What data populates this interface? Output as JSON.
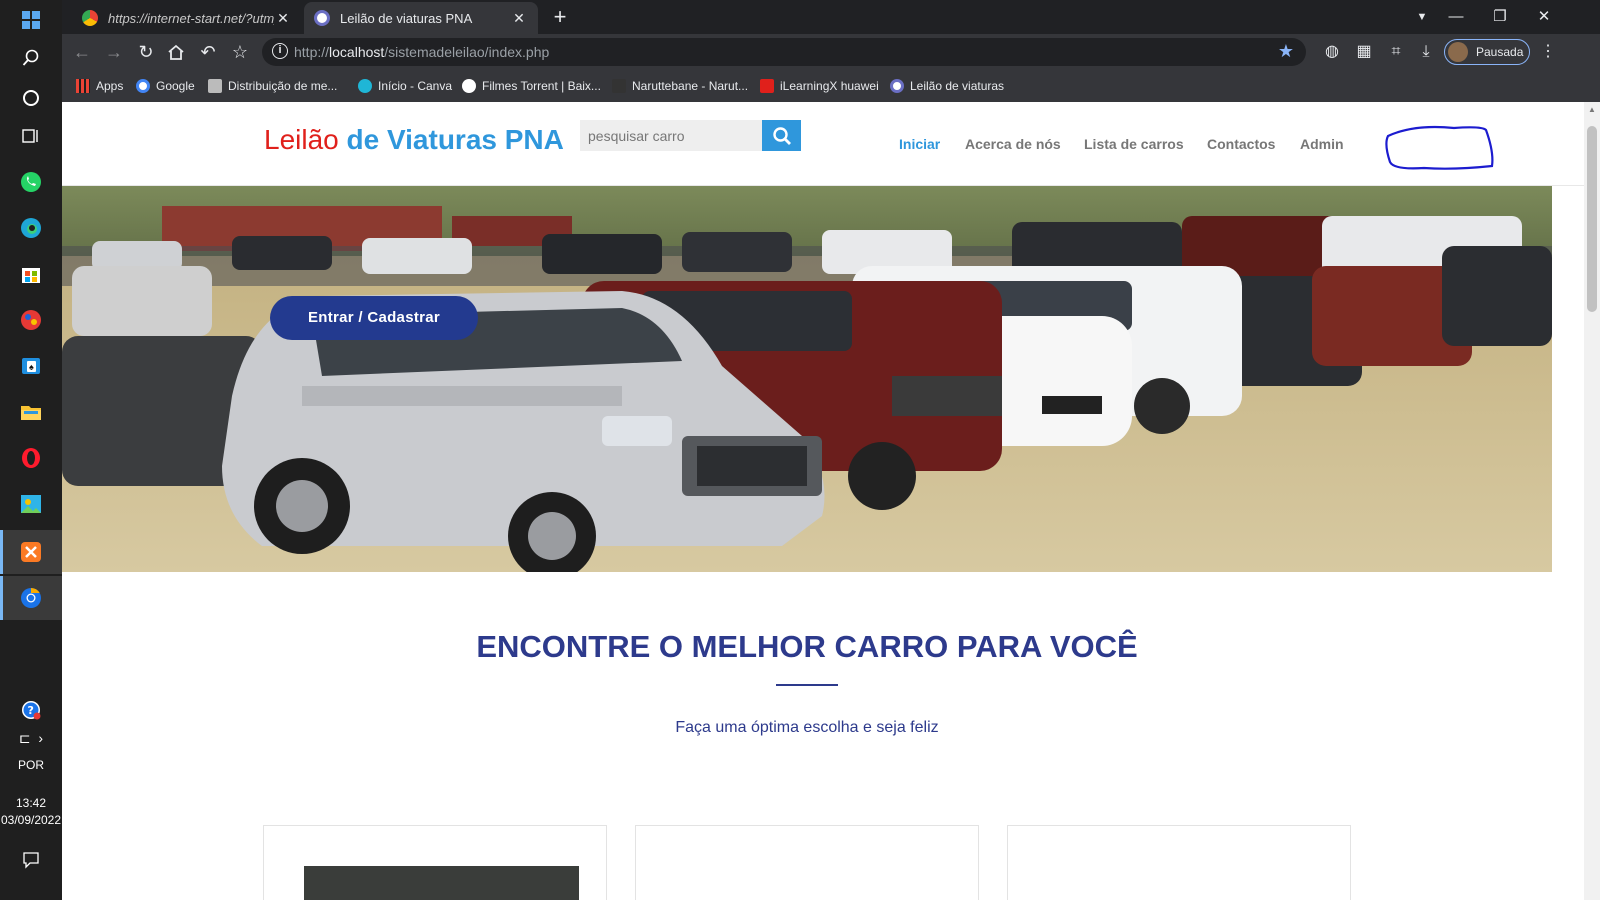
{
  "taskbar": {
    "language": "POR",
    "time": "13:42",
    "date": "03/09/2022"
  },
  "browser": {
    "tabs": [
      {
        "title": "https://internet-start.net/?utm_so",
        "active": false
      },
      {
        "title": "Leilão de viaturas PNA",
        "active": true
      }
    ],
    "url_prefix": "http://",
    "url_host": "localhost",
    "url_path": "/sistemadeleilao/index.php",
    "profile_label": "Pausada",
    "bookmarks": [
      {
        "label": "Apps"
      },
      {
        "label": "Google"
      },
      {
        "label": "Distribuição de me..."
      },
      {
        "label": "Início - Canva"
      },
      {
        "label": "Filmes Torrent | Baix..."
      },
      {
        "label": "Naruttebane - Narut..."
      },
      {
        "label": "iLearningX huawei"
      },
      {
        "label": "Leilão de viaturas"
      }
    ]
  },
  "site": {
    "brand_part1": "Leilão",
    "brand_part2": "de Viaturas PNA",
    "search_placeholder": "pesquisar carro",
    "nav": [
      {
        "label": "Iniciar",
        "active": true
      },
      {
        "label": "Acerca de nós",
        "active": false
      },
      {
        "label": "Lista de carros",
        "active": false
      },
      {
        "label": "Contactos",
        "active": false
      },
      {
        "label": "Admin",
        "active": false
      }
    ],
    "cta_label": "Entrar / Cadastrar",
    "section_title": "ENCONTRE O MELHOR CARRO PARA VOCÊ",
    "section_subtitle": "Faça uma óptima escolha e seja feliz"
  },
  "colors": {
    "brand_red": "#e0201b",
    "brand_blue": "#2f97dc",
    "navy": "#2d3a8c",
    "cta": "#233a8f"
  }
}
